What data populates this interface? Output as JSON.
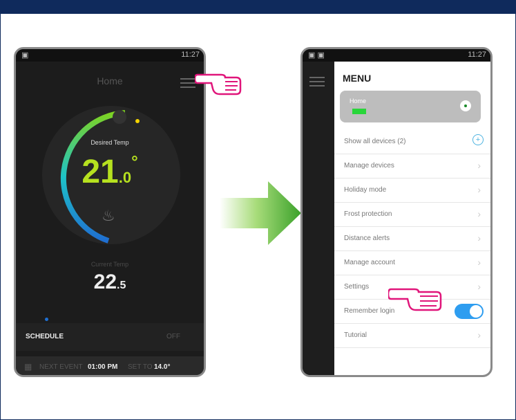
{
  "phone1": {
    "status_time": "11:27",
    "title": "Home",
    "desired_label": "Desired Temp",
    "desired_temp_int": "21",
    "desired_temp_dec": ".0",
    "current_label": "Current Temp",
    "current_temp_int": "22",
    "current_temp_dec": ".5",
    "schedule_label": "SCHEDULE",
    "off_label": "OFF",
    "next_event_label": "NEXT EVENT",
    "next_event_time": "01:00 PM",
    "set_to_label": "SET TO",
    "set_to_temp": "14.0°"
  },
  "phone2": {
    "status_time": "11:27",
    "menu_title": "MENU",
    "home_label": "Home",
    "items": [
      {
        "label": "Show all devices (2)"
      },
      {
        "label": "Manage devices"
      },
      {
        "label": "Holiday mode"
      },
      {
        "label": "Frost protection"
      },
      {
        "label": "Distance alerts"
      },
      {
        "label": "Manage account"
      },
      {
        "label": "Settings"
      },
      {
        "label": "Remember login"
      },
      {
        "label": "Tutorial"
      }
    ]
  },
  "colors": {
    "accent_green": "#b6e11f",
    "toggle_blue": "#2e9df0",
    "pointer_pink": "#e0157a",
    "arrow_green": "#5ab52e",
    "frame_navy": "#0f2a5c"
  }
}
